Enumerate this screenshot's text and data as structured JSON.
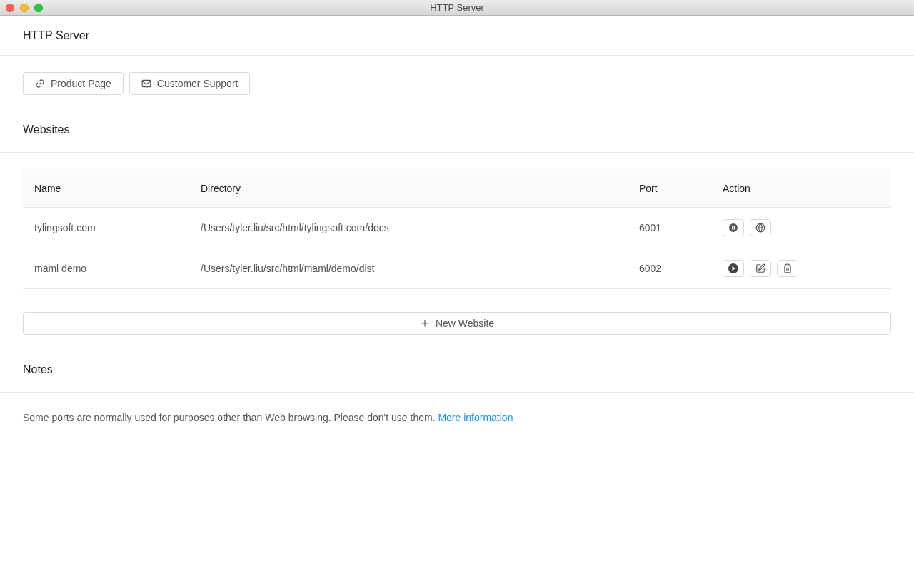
{
  "window": {
    "title": "HTTP Server"
  },
  "header": {
    "title": "HTTP Server"
  },
  "links": [
    {
      "kind": "link",
      "label": "Product Page"
    },
    {
      "kind": "mail",
      "label": "Customer Support"
    }
  ],
  "websites": {
    "title": "Websites",
    "columns": [
      "Name",
      "Directory",
      "Port",
      "Action"
    ],
    "rows": [
      {
        "name": "tylingsoft.com",
        "directory": "/Users/tyler.liu/src/html/tylingsoft.com/docs",
        "port": "6001",
        "running": true
      },
      {
        "name": "maml demo",
        "directory": "/Users/tyler.liu/src/html/maml/demo/dist",
        "port": "6002",
        "running": false
      }
    ],
    "add_button": "New Website"
  },
  "notes": {
    "title": "Notes",
    "text": "Some ports are normally used for purposes other than Web browsing. Please don't use them.",
    "link": "More information"
  }
}
